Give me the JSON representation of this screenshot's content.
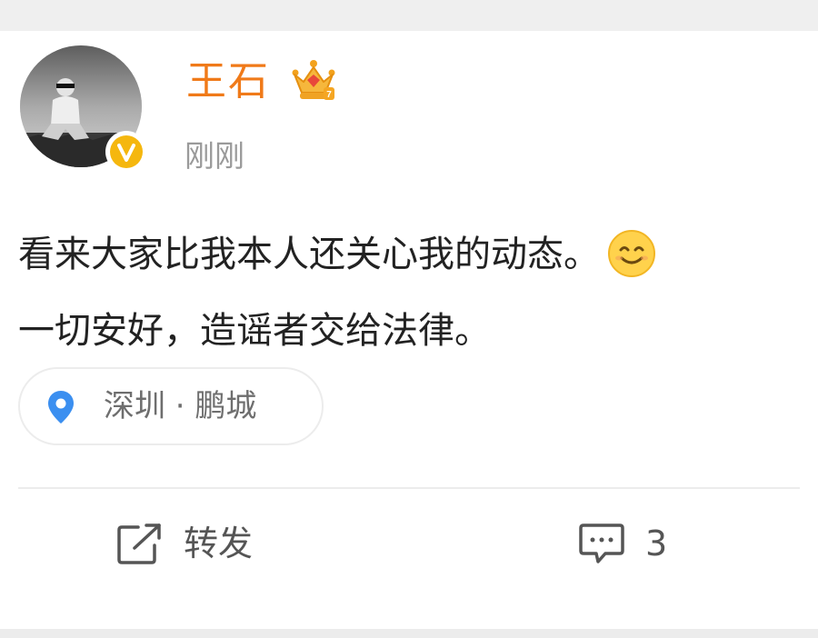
{
  "post": {
    "author": {
      "name": "王石",
      "avatar_icon": "avatar-photo",
      "verified_icon": "verified-v-icon",
      "member_icon": "crown-icon",
      "name_color": "#f07a19"
    },
    "timestamp": "刚刚",
    "content": {
      "line1": "看来大家比我本人还关心我的动态。",
      "line1_emoji": "smile-icon",
      "line2": "一切安好，造谣者交给法律。"
    },
    "location": {
      "icon": "location-pin-icon",
      "label": "深圳 · 鹏城",
      "pin_color": "#3b8ff0"
    }
  },
  "actions": {
    "repost": {
      "icon": "repost-icon",
      "label": "转发"
    },
    "comment": {
      "icon": "comment-icon",
      "count": "3"
    }
  }
}
